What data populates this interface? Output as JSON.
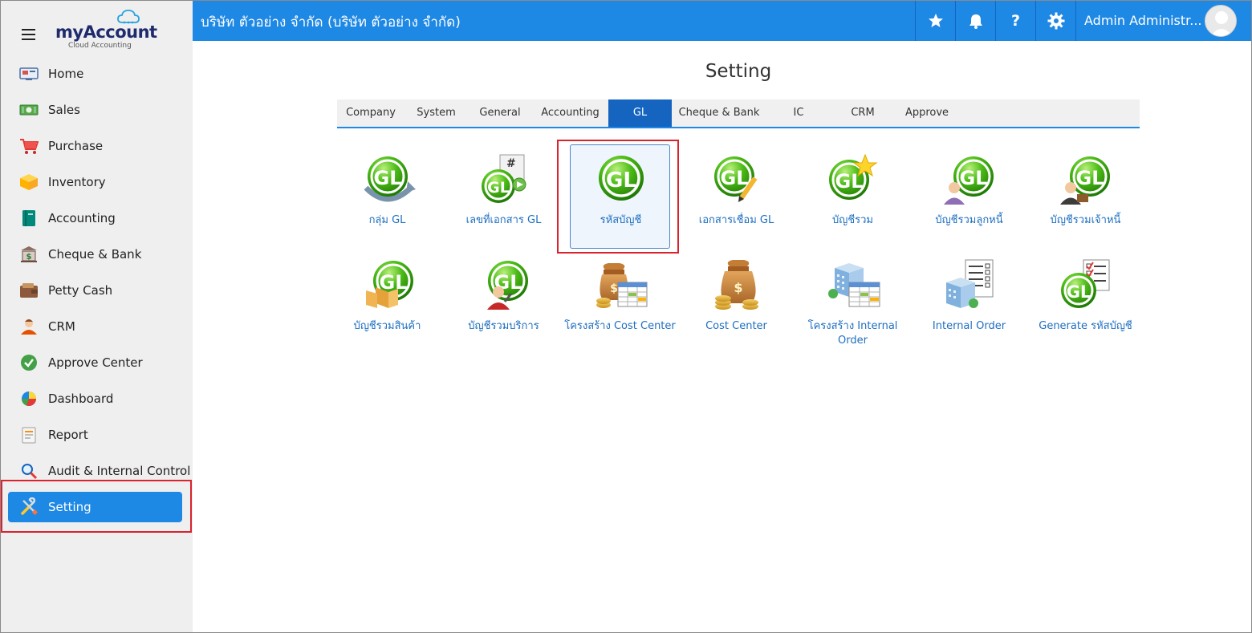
{
  "brand": {
    "name_my": "my",
    "name_account": "Account",
    "tagline": "Cloud Accounting"
  },
  "sidebar": {
    "items": [
      {
        "label": "Home",
        "icon": "home-icon"
      },
      {
        "label": "Sales",
        "icon": "sales-icon"
      },
      {
        "label": "Purchase",
        "icon": "cart-icon"
      },
      {
        "label": "Inventory",
        "icon": "box-icon"
      },
      {
        "label": "Accounting",
        "icon": "book-icon"
      },
      {
        "label": "Cheque & Bank",
        "icon": "bank-icon"
      },
      {
        "label": "Petty Cash",
        "icon": "wallet-icon"
      },
      {
        "label": "CRM",
        "icon": "crm-icon"
      },
      {
        "label": "Approve Center",
        "icon": "check-icon"
      },
      {
        "label": "Dashboard",
        "icon": "pie-icon"
      },
      {
        "label": "Report",
        "icon": "report-icon"
      },
      {
        "label": "Audit & Internal Control",
        "icon": "magnifier-icon"
      },
      {
        "label": "Setting",
        "icon": "tools-icon",
        "active": true
      }
    ]
  },
  "topbar": {
    "company": "บริษัท ตัวอย่าง จำกัด (บริษัท ตัวอย่าง จำกัด)",
    "user": "Admin Administr...",
    "icons": [
      "star-icon",
      "bell-icon",
      "help-icon",
      "gear-icon"
    ],
    "help_glyph": "?"
  },
  "main": {
    "title": "Setting",
    "tabs": [
      "Company",
      "System",
      "General",
      "Accounting",
      "GL",
      "Cheque & Bank",
      "IC",
      "CRM",
      "Approve"
    ],
    "active_tab": "GL",
    "tiles": [
      {
        "label": "กลุ่ม GL",
        "icon": "gl-group-icon"
      },
      {
        "label": "เลขที่เอกสาร GL",
        "icon": "gl-docno-icon",
        "badge": "#"
      },
      {
        "label": "รหัสบัญชี",
        "icon": "gl-account-code-icon",
        "selected": true
      },
      {
        "label": "เอกสารเชื่อม GL",
        "icon": "gl-link-doc-icon"
      },
      {
        "label": "บัญชีรวม",
        "icon": "gl-control-account-icon"
      },
      {
        "label": "บัญชีรวมลูกหนี้",
        "icon": "gl-debtor-icon"
      },
      {
        "label": "บัญชีรวมเจ้าหนี้",
        "icon": "gl-creditor-icon"
      },
      {
        "label": "บัญชีรวมสินค้า",
        "icon": "gl-inventory-icon"
      },
      {
        "label": "บัญชีรวมบริการ",
        "icon": "gl-service-icon"
      },
      {
        "label": "โครงสร้าง Cost Center",
        "icon": "cost-center-structure-icon"
      },
      {
        "label": "Cost Center",
        "icon": "cost-center-icon"
      },
      {
        "label": "โครงสร้าง Internal Order",
        "icon": "internal-order-structure-icon"
      },
      {
        "label": "Internal Order",
        "icon": "internal-order-icon"
      },
      {
        "label": "Generate รหัสบัญชี",
        "icon": "generate-account-icon"
      }
    ],
    "gl_mark": "GL"
  },
  "colors": {
    "primary": "#1e88e5",
    "highlight": "#d9232e",
    "link": "#1e6fc0",
    "gl_green": "#3fae16"
  }
}
